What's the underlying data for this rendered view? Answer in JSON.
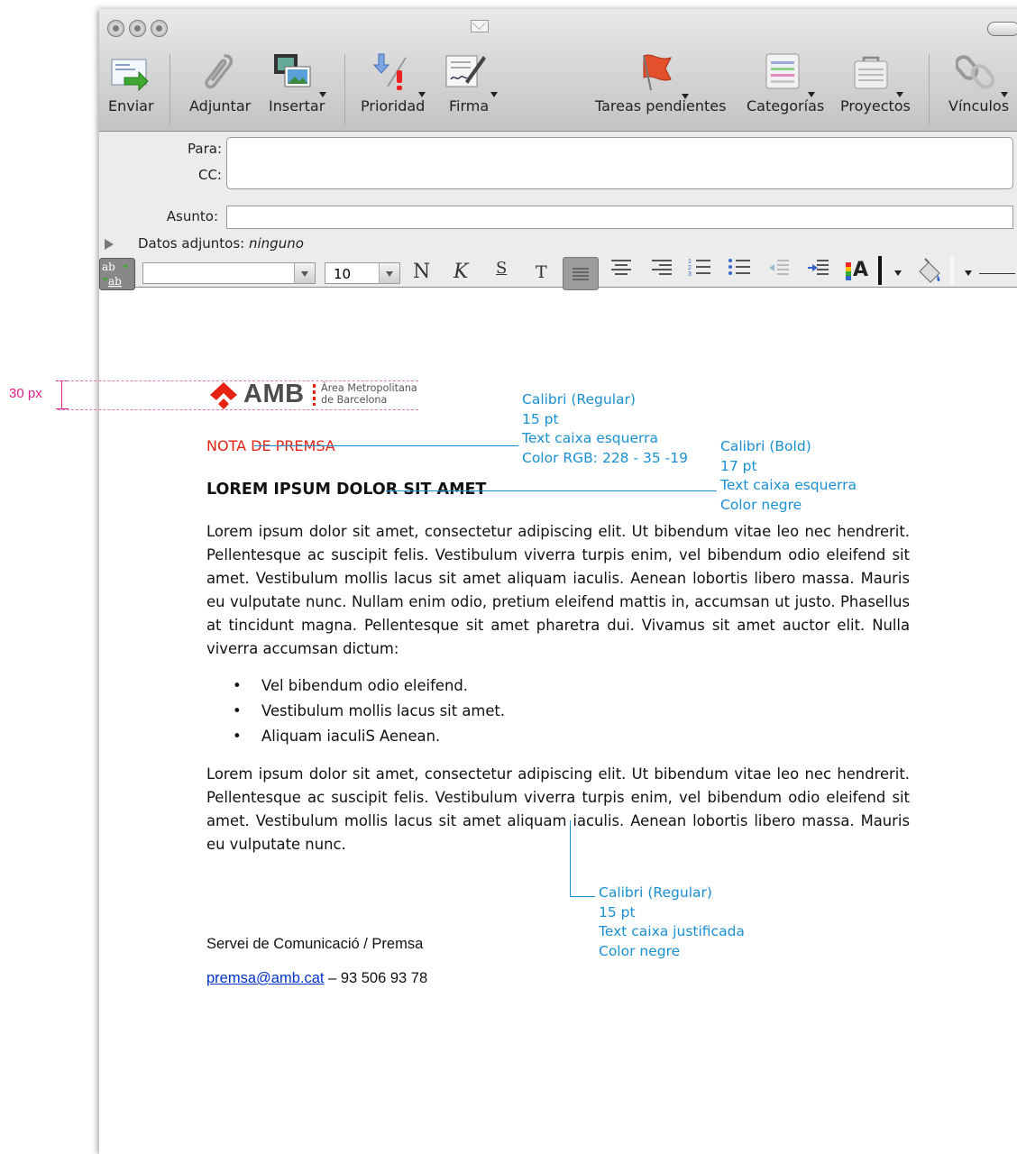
{
  "toolbar": {
    "buttons": [
      {
        "label": "Enviar",
        "icon": "send-icon"
      },
      {
        "label": "Adjuntar",
        "icon": "paperclip-icon"
      },
      {
        "label": "Insertar",
        "icon": "insert-media-icon"
      },
      {
        "label": "Prioridad",
        "icon": "priority-icon"
      },
      {
        "label": "Firma",
        "icon": "signature-icon"
      },
      {
        "label": "Tareas pendientes",
        "icon": "flag-icon"
      },
      {
        "label": "Categorías",
        "icon": "categories-icon"
      },
      {
        "label": "Proyectos",
        "icon": "projects-icon"
      },
      {
        "label": "Vínculos",
        "icon": "links-icon"
      }
    ]
  },
  "header": {
    "to_label": "Para:",
    "cc_label": "CC:",
    "subject_label": "Asunto:",
    "attachments_label": "Datos adjuntos:",
    "attachments_value": "ninguno"
  },
  "format_bar": {
    "font_size": "10",
    "bold": "N",
    "italic": "K",
    "underline": "S",
    "text": "T",
    "font_color_icon": "A"
  },
  "annotation_left": {
    "label": "30 px"
  },
  "logo": {
    "text": "AMB",
    "line1": "Àrea Metropolitana",
    "line2": "de Barcelona"
  },
  "doc": {
    "kicker": "NOTA DE PREMSA",
    "title": "LOREM IPSUM DOLOR SIT AMET",
    "para1": "Lorem ipsum dolor sit amet, consectetur adipiscing elit. Ut bibendum vitae leo nec hendrerit. Pellentesque ac suscipit felis. Vestibulum viverra turpis enim, vel bibendum odio eleifend sit amet. Vestibulum mollis lacus sit amet aliquam iaculis. Aenean lobortis libero massa. Mauris eu vulputate nunc. Nullam enim odio, pretium eleifend mattis in, accumsan ut justo. Phasellus at tincidunt magna. Pellentesque sit amet pharetra dui. Vivamus sit amet auctor elit. Nulla viverra accumsan dictum:",
    "bullets": [
      "Vel bibendum odio eleifend.",
      "Vestibulum mollis lacus sit amet.",
      "Aliquam iaculiS Aenean."
    ],
    "para2": "Lorem ipsum dolor sit amet, consectetur adipiscing elit. Ut bibendum vitae leo nec hendrerit. Pellentesque ac suscipit felis. Vestibulum viverra turpis enim, vel bibendum odio eleifend sit amet. Vestibulum mollis lacus sit amet aliquam iaculis. Aenean lobortis libero massa. Mauris eu vulputate nunc.",
    "signature": "Servei de Comunicació / Premsa",
    "email": "premsa@amb.cat",
    "phone": " – 93 506 93 78"
  },
  "notes": {
    "kicker_note": "Calibri (Regular)\n15 pt\nText caixa esquerra\nColor RGB: 228 - 35 -19",
    "title_note": "Calibri (Bold)\n17 pt\nText caixa esquerra\nColor negre",
    "body_note": "Calibri (Regular)\n15 pt\nText caixa justificada\nColor negre"
  },
  "colors": {
    "kicker": "#e42313",
    "annotation": "#1a8fd1",
    "guide_pink": "#e0208a",
    "logo_red": "#e42313",
    "logo_gray": "#4d4d4d"
  }
}
